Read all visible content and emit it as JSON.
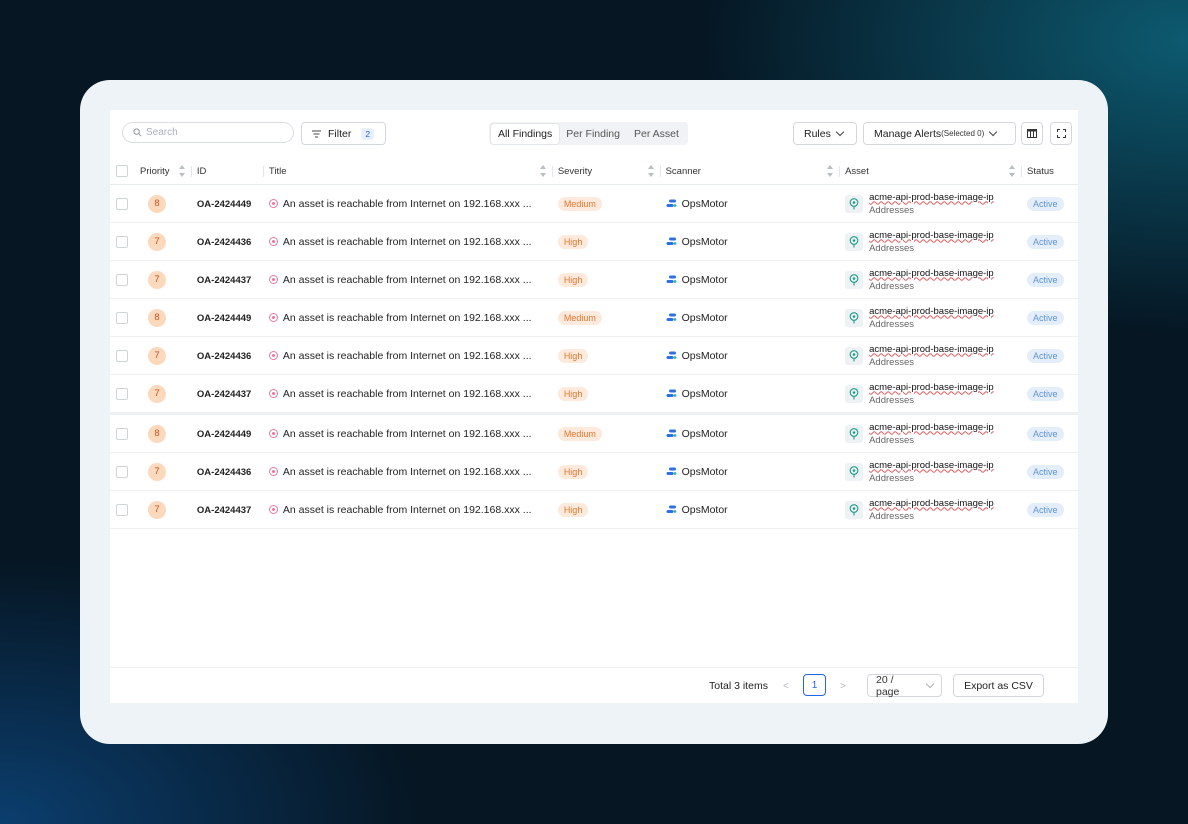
{
  "toolbar": {
    "search_placeholder": "Search",
    "filter_label": "Filter",
    "filter_count": "2",
    "view_tabs": [
      {
        "label": "All Findings",
        "active": true
      },
      {
        "label": "Per Finding",
        "active": false
      },
      {
        "label": "Per Asset",
        "active": false
      }
    ],
    "rules_label": "Rules",
    "manage_alerts_label": "Manage Alerts",
    "manage_alerts_selected": "(Selected 0)",
    "columns_icon": "table-columns-icon",
    "fullscreen_icon": "fullscreen-icon"
  },
  "table": {
    "columns": [
      "Priority",
      "ID",
      "Title",
      "Severity",
      "Scanner",
      "Asset",
      "Status"
    ],
    "rows": [
      {
        "priority": "8",
        "id": "OA-2424449",
        "title": "An asset is reachable from Internet on 192.168.xxx ...",
        "severity": "Medium",
        "scanner": "OpsMotor",
        "asset_name": "acme-api-prod-base-image-ip",
        "asset_type": "Addresses",
        "status": "Active"
      },
      {
        "priority": "7",
        "id": "OA-2424436",
        "title": "An asset is reachable from Internet on 192.168.xxx ...",
        "severity": "High",
        "scanner": "OpsMotor",
        "asset_name": "acme-api-prod-base-image-ip",
        "asset_type": "Addresses",
        "status": "Active"
      },
      {
        "priority": "7",
        "id": "OA-2424437",
        "title": "An asset is reachable from Internet on 192.168.xxx ...",
        "severity": "High",
        "scanner": "OpsMotor",
        "asset_name": "acme-api-prod-base-image-ip",
        "asset_type": "Addresses",
        "status": "Active"
      },
      {
        "priority": "8",
        "id": "OA-2424449",
        "title": "An asset is reachable from Internet on 192.168.xxx ...",
        "severity": "Medium",
        "scanner": "OpsMotor",
        "asset_name": "acme-api-prod-base-image-ip",
        "asset_type": "Addresses",
        "status": "Active"
      },
      {
        "priority": "7",
        "id": "OA-2424436",
        "title": "An asset is reachable from Internet on 192.168.xxx ...",
        "severity": "High",
        "scanner": "OpsMotor",
        "asset_name": "acme-api-prod-base-image-ip",
        "asset_type": "Addresses",
        "status": "Active"
      },
      {
        "priority": "7",
        "id": "OA-2424437",
        "title": "An asset is reachable from Internet on 192.168.xxx ...",
        "severity": "High",
        "scanner": "OpsMotor",
        "asset_name": "acme-api-prod-base-image-ip",
        "asset_type": "Addresses",
        "status": "Active"
      },
      {
        "priority": "8",
        "id": "OA-2424449",
        "title": "An asset is reachable from Internet on 192.168.xxx ...",
        "severity": "Medium",
        "scanner": "OpsMotor",
        "asset_name": "acme-api-prod-base-image-ip",
        "asset_type": "Addresses",
        "status": "Active"
      },
      {
        "priority": "7",
        "id": "OA-2424436",
        "title": "An asset is reachable from Internet on 192.168.xxx ...",
        "severity": "High",
        "scanner": "OpsMotor",
        "asset_name": "acme-api-prod-base-image-ip",
        "asset_type": "Addresses",
        "status": "Active"
      },
      {
        "priority": "7",
        "id": "OA-2424437",
        "title": "An asset is reachable from Internet on 192.168.xxx ...",
        "severity": "High",
        "scanner": "OpsMotor",
        "asset_name": "acme-api-prod-base-image-ip",
        "asset_type": "Addresses",
        "status": "Active"
      }
    ]
  },
  "footer": {
    "total_label": "Total 3 items",
    "current_page": "1",
    "page_size_label": "20 / page",
    "export_label": "Export as CSV"
  },
  "colors": {
    "accent": "#2563eb",
    "priority_bg": "#fcd9bd",
    "severity_bg": "#feeadc",
    "status_bg": "#e4eefb"
  }
}
